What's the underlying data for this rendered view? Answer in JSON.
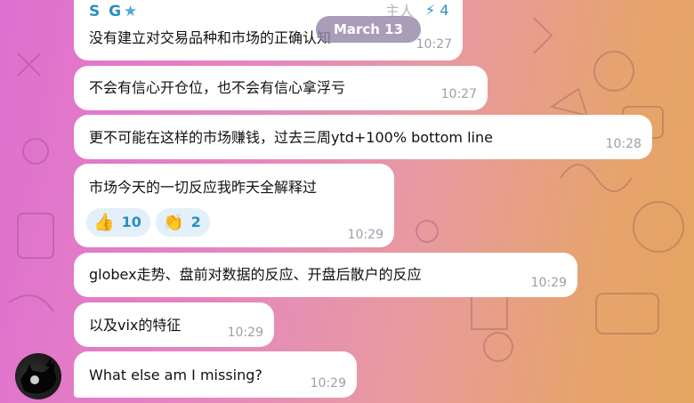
{
  "chat": {
    "sender_name": "S G",
    "sender_role": "主人",
    "boost_count": "4",
    "date_label": "March 13"
  },
  "messages": [
    {
      "text": "没有建立对交易品种和市场的正确认知",
      "time": "10:27"
    },
    {
      "text": "不会有信心开仓位，也不会有信心拿浮亏",
      "time": "10:27"
    },
    {
      "text": "更不可能在这样的市场赚钱，过去三周ytd+100% bottom line",
      "time": "10:28"
    },
    {
      "text": "市场今天的一切反应我昨天全解释过",
      "time": "10:29",
      "reactions": [
        {
          "emoji": "👍",
          "icon": "thumbs-up-icon",
          "count": "10"
        },
        {
          "emoji": "👏",
          "icon": "clapping-hands-icon",
          "count": "2"
        }
      ]
    },
    {
      "text": "globex走势、盘前对数据的反应、开盘后散户的反应",
      "time": "10:29"
    },
    {
      "text": "以及vix的特征",
      "time": "10:29"
    },
    {
      "text": "What else am I missing?",
      "time": "10:29"
    }
  ],
  "colors": {
    "sender_name": "#2b8fc1",
    "bubble": "#ffffff",
    "timestamp": "#9aa1a8",
    "reaction_bg": "#e3f0f9"
  }
}
